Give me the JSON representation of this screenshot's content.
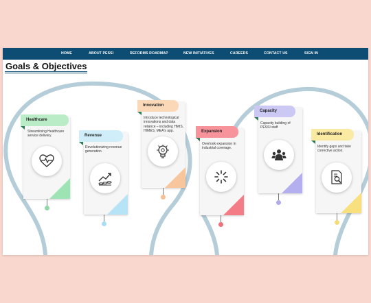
{
  "nav": {
    "items": [
      "HOME",
      "ABOUT PESSI",
      "REFORMS ROADMAP",
      "NEW INITIATIVES",
      "CAREERS",
      "CONTACT US",
      "SIGN IN"
    ]
  },
  "page": {
    "title": "Goals & Objectives"
  },
  "colors": {
    "page_background": "#f9d7ce",
    "nav_background": "#0d4d73",
    "bulb_outline": "#b5cdd8"
  },
  "cards": [
    {
      "title": "Healthcare",
      "description": "Streamlining Healthcare service delivery.",
      "icon": "heart-pulse-icon",
      "color": "#b9ecc7",
      "fold": "#9ee3b4",
      "dot": "#8ed9a7"
    },
    {
      "title": "Revenue",
      "description": "Revolutionizing revenue generation.",
      "icon": "growth-chart-icon",
      "color": "#cfeefa",
      "fold": "#b6e4f6",
      "dot": "#a9def2"
    },
    {
      "title": "Innovation",
      "description": "Introduce technological innovations and data reliance – including HMIS, HIMES, MEA's app.",
      "icon": "innovation-bulb-icon",
      "color": "#fbd8b8",
      "fold": "#f8c69c",
      "dot": "#f7c094"
    },
    {
      "title": "Expansion",
      "description": "Overlook expansion in industrial coverage.",
      "icon": "loading-icon",
      "color": "#f7939b",
      "fold": "#f47c86",
      "dot": "#f0707a"
    },
    {
      "title": "Capacity",
      "description": "Capacity building of PESSI staff",
      "icon": "people-icon",
      "color": "#cbc8f4",
      "fold": "#b4b0f0",
      "dot": "#b0acec"
    },
    {
      "title": "Identification",
      "description": "Identify gaps and take corrective action.",
      "icon": "document-search-icon",
      "color": "#fbeaa1",
      "fold": "#f8e07f",
      "dot": "#f5db7a"
    }
  ]
}
